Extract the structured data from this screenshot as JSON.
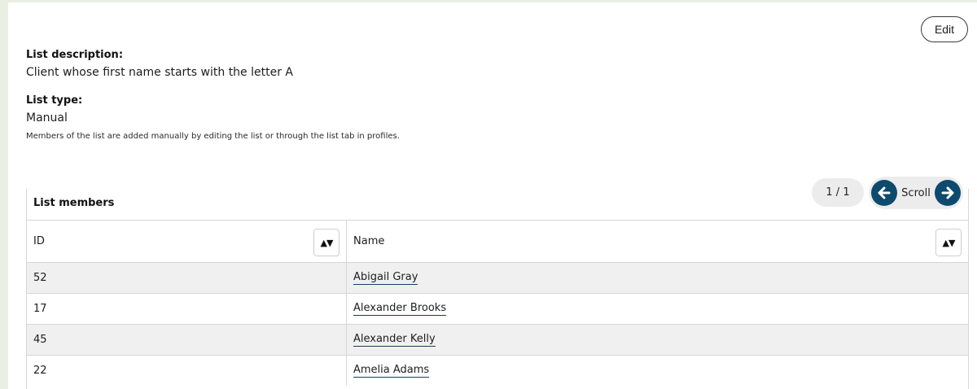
{
  "header": {
    "edit_label": "Edit"
  },
  "details": {
    "description_label": "List description:",
    "description_value": "Client whose first name starts with the letter A",
    "type_label": "List type:",
    "type_value": "Manual",
    "type_note": "Members of the list are added manually by editing the list or through the list tab in profiles."
  },
  "pagination": {
    "page_indicator": "1 / 1",
    "scroll_label": "Scroll",
    "left_icon": "arrow-left-icon",
    "right_icon": "arrow-right-icon"
  },
  "table": {
    "caption": "List members",
    "columns": [
      "ID",
      "Name"
    ],
    "sort_icon": "sort-icon",
    "rows": [
      {
        "id": "52",
        "name": "Abigail Gray"
      },
      {
        "id": "17",
        "name": "Alexander Brooks"
      },
      {
        "id": "45",
        "name": "Alexander Kelly"
      },
      {
        "id": "22",
        "name": "Amelia Adams"
      }
    ]
  },
  "colors": {
    "accent": "#0e4a6e",
    "panel_accent": "#e9efe2",
    "shaded_row": "#f0f0f0"
  }
}
